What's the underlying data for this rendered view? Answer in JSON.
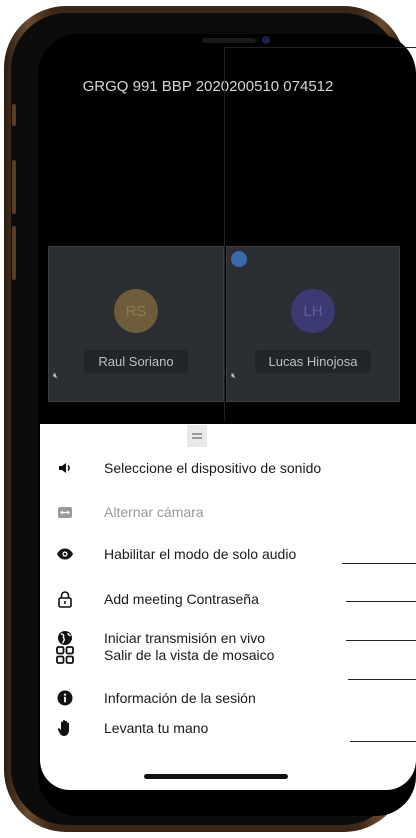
{
  "room": {
    "title": "GRGQ 991 BBP 2020200510 074512"
  },
  "participants": [
    {
      "initials": "RS",
      "name": "Raul Soriano",
      "avatar_color": "#6e5d3a",
      "initials_color": "#8e7a52"
    },
    {
      "initials": "LH",
      "name": "Lucas Hinojosa",
      "avatar_color": "#3c3a73",
      "initials_color": "#5e5ba3"
    }
  ],
  "menu": {
    "items": [
      {
        "label": "Seleccione el dispositivo de sonido",
        "icon": "volume-icon",
        "enabled": true
      },
      {
        "label": "Alternar cámara",
        "icon": "switch-camera-icon",
        "enabled": false
      },
      {
        "label": "Habilitar el modo de solo audio",
        "icon": "eye-icon",
        "enabled": true
      },
      {
        "label": "Add meeting Contraseña",
        "icon": "lock-icon",
        "enabled": true
      },
      {
        "label": "Iniciar transmisión en vivo",
        "icon": "globe-icon",
        "enabled": true
      },
      {
        "label": "Salir de la vista de mosaico",
        "icon": "tile-grid-icon",
        "enabled": true
      },
      {
        "label": "Información de la sesión",
        "icon": "info-icon",
        "enabled": true
      },
      {
        "label": "Levanta tu mano",
        "icon": "raise-hand-icon",
        "enabled": true
      }
    ]
  },
  "colors": {
    "frame": "#3a2717",
    "screen_bg": "#000000",
    "tile_bg": "#2b2f34",
    "sheet_bg": "#ffffff"
  }
}
